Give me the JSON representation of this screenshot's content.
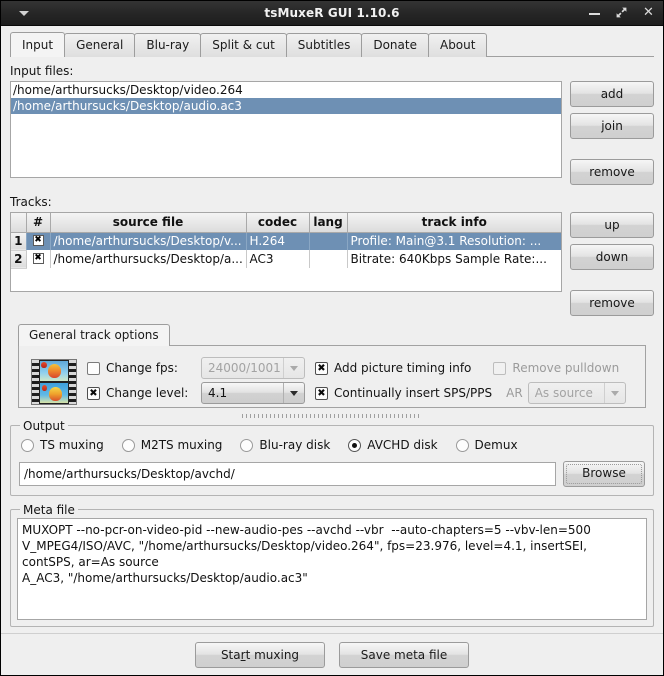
{
  "window": {
    "title": "tsMuxeR GUI 1.10.6",
    "menu_icon": "chevron-down-icon",
    "minimize_label": "",
    "maximize_label": "",
    "close_label": "✕"
  },
  "tabs": [
    {
      "label": "Input",
      "active": true
    },
    {
      "label": "General",
      "active": false
    },
    {
      "label": "Blu-ray",
      "active": false
    },
    {
      "label": "Split & cut",
      "active": false
    },
    {
      "label": "Subtitles",
      "active": false
    },
    {
      "label": "Donate",
      "active": false
    },
    {
      "label": "About",
      "active": false
    }
  ],
  "input_files": {
    "label": "Input files:",
    "items": [
      {
        "path": "/home/arthursucks/Desktop/video.264",
        "selected": false
      },
      {
        "path": "/home/arthursucks/Desktop/audio.ac3",
        "selected": true
      }
    ],
    "buttons": {
      "add": "add",
      "join": "join",
      "remove": "remove"
    }
  },
  "tracks": {
    "label": "Tracks:",
    "columns": [
      "",
      "#",
      "source file",
      "codec",
      "lang",
      "track info"
    ],
    "rows": [
      {
        "num": "1",
        "enabled": true,
        "source_file": "/home/arthursucks/Desktop/v...",
        "codec": "H.264",
        "lang": "",
        "track_info": "Profile: Main@3.1  Resolution: ...",
        "selected": true
      },
      {
        "num": "2",
        "enabled": true,
        "source_file": "/home/arthursucks/Desktop/a...",
        "codec": "AC3",
        "lang": "",
        "track_info": "Bitrate: 640Kbps Sample Rate:...",
        "selected": false
      }
    ],
    "buttons": {
      "up": "up",
      "down": "down",
      "remove": "remove"
    }
  },
  "track_options": {
    "tab_label": "General track options",
    "thumbnail_icon": "film-strip-thumbnail-icon",
    "change_fps": {
      "label": "Change fps:",
      "checked": false,
      "value": "24000/1001",
      "disabled": true
    },
    "change_level": {
      "label": "Change level:",
      "checked": true,
      "value": "4.1",
      "disabled": false
    },
    "add_picture_timing": {
      "label": "Add picture timing info",
      "checked": true,
      "disabled": false
    },
    "continually_insert_sps_pps": {
      "label": "Continually insert SPS/PPS",
      "checked": true,
      "disabled": false
    },
    "remove_pulldown": {
      "label": "Remove pulldown",
      "checked": false,
      "disabled": true
    },
    "aspect_ratio": {
      "label": "AR",
      "value": "As source",
      "disabled": true
    }
  },
  "output": {
    "group_label": "Output",
    "modes": [
      {
        "label": "TS muxing",
        "selected": false
      },
      {
        "label": "M2TS muxing",
        "selected": false
      },
      {
        "label": "Blu-ray disk",
        "selected": false
      },
      {
        "label": "AVCHD disk",
        "selected": true
      },
      {
        "label": "Demux",
        "selected": false
      }
    ],
    "path_value": "/home/arthursucks/Desktop/avchd/",
    "browse_label": "Browse"
  },
  "meta_file": {
    "group_label": "Meta file",
    "lines": [
      "MUXOPT --no-pcr-on-video-pid --new-audio-pes --avchd --vbr  --auto-chapters=5 --vbv-len=500",
      "V_MPEG4/ISO/AVC, \"/home/arthursucks/Desktop/video.264\", fps=23.976, level=4.1, insertSEI, contSPS, ar=As source",
      "A_AC3, \"/home/arthursucks/Desktop/audio.ac3\""
    ]
  },
  "footer": {
    "start_muxing_pre": "Sta",
    "start_muxing_mnemonic": "r",
    "start_muxing_post": "t muxing",
    "save_meta_file": "Save meta file"
  },
  "colors": {
    "selection_blue": "#6e90b4",
    "titlebar_dark": "#262626",
    "window_bg": "#efefef"
  }
}
